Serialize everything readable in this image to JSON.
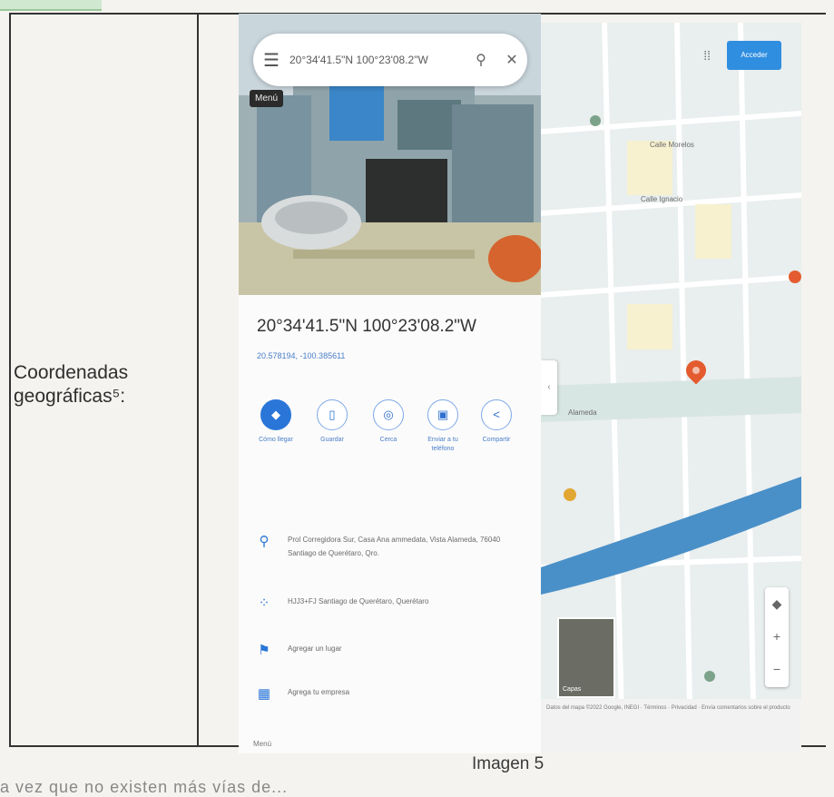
{
  "document": {
    "label": "Coordenadas\ngeográficas⁵:",
    "caption": "Imagen 5",
    "bottom_text": "a vez que no existen más vías de..."
  },
  "maps": {
    "search_text": "20°34'41.5\"N 100°23'08.2\"W",
    "photo_chip": "Menú",
    "place_title": "20°34'41.5\"N 100°23'08.2\"W",
    "place_subtitle": "20.578194, -100.385611",
    "actions": [
      {
        "label": "Cómo llegar",
        "glyph": "◆"
      },
      {
        "label": "Guardar",
        "glyph": "▯"
      },
      {
        "label": "Cerca",
        "glyph": "◎"
      },
      {
        "label": "Enviar a tu teléfono",
        "glyph": "▣"
      },
      {
        "label": "Compartir",
        "glyph": "<"
      }
    ],
    "details": [
      {
        "icon": "location-pin-icon",
        "glyph": "⚲",
        "text": "Prol Corregidora Sur, Casa Ana ammedata, Vista Alameda, 76040 Santiago de Querétaro, Qro."
      },
      {
        "icon": "plus-code-icon",
        "glyph": "⁘",
        "text": "HJJ3+FJ Santiago de Querétaro, Querétaro"
      },
      {
        "icon": "add-place-icon",
        "glyph": "⚑",
        "text": "Agregar un lugar"
      },
      {
        "icon": "add-business-icon",
        "glyph": "▦",
        "text": "Agrega tu empresa"
      }
    ],
    "more_link": "Menú",
    "signin_label": "Acceder",
    "thumb_label": "Capas",
    "street_labels": [
      "Calle Morelos",
      "Calle Ignacio",
      "Alameda"
    ],
    "map_footer": "Datos del mapa ©2022 Google, INEGI · Términos · Privacidad · Envía comentarios sobre el producto",
    "colors": {
      "accent": "#2a76d8",
      "pin": "#e35b2f",
      "river": "#4a90c8"
    }
  }
}
